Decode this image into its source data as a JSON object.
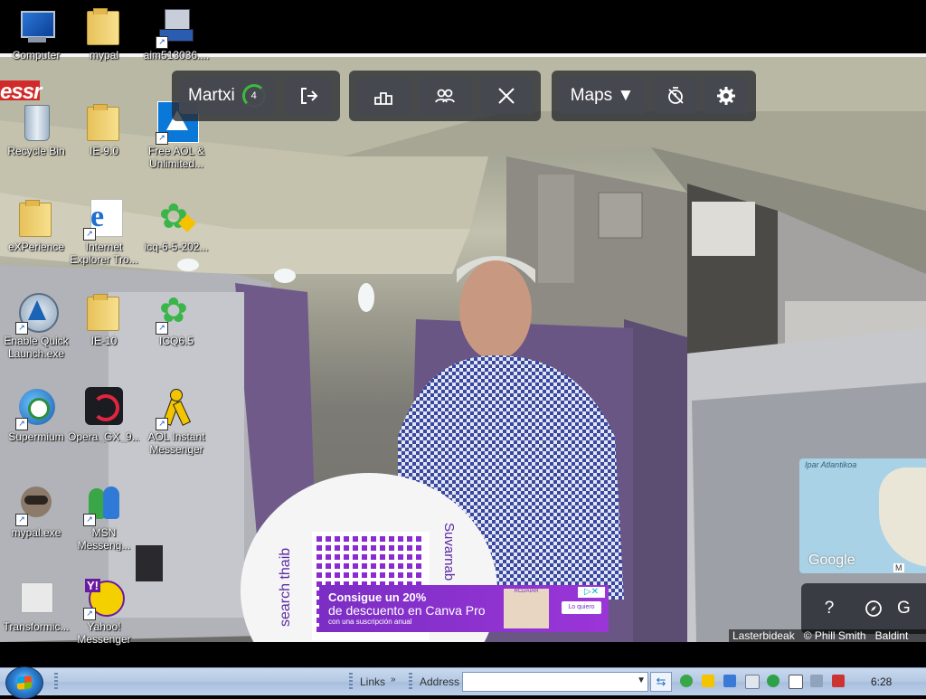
{
  "desktop": {
    "icons": [
      {
        "label": "Computer",
        "icon": "computer-icon"
      },
      {
        "label": "mypal",
        "icon": "folder-icon"
      },
      {
        "label": "aim513036....",
        "icon": "installer-icon"
      },
      {
        "label": "Recycle Bin",
        "icon": "recycle-bin-icon"
      },
      {
        "label": "IE-9.0",
        "icon": "folder-icon"
      },
      {
        "label": "Free AOL & Unlimited...",
        "icon": "aol-icon"
      },
      {
        "label": "eXPerience",
        "icon": "folder-icon"
      },
      {
        "label": "Internet Explorer Tro...",
        "icon": "internet-explorer-icon"
      },
      {
        "label": "icq-6-5-202...",
        "icon": "icq-installer-icon"
      },
      {
        "label": "Enable Quick Launch.exe",
        "icon": "quick-launch-icon"
      },
      {
        "label": "IE-10",
        "icon": "folder-icon"
      },
      {
        "label": "ICQ6.5",
        "icon": "icq-icon"
      },
      {
        "label": "Supermium",
        "icon": "supermium-icon"
      },
      {
        "label": "Opera_GX_9...",
        "icon": "opera-gx-icon"
      },
      {
        "label": "AOL Instant Messenger",
        "icon": "aim-icon"
      },
      {
        "label": "mypal.exe",
        "icon": "mypal-raccoon-icon"
      },
      {
        "label": "MSN Messeng...",
        "icon": "msn-messenger-icon"
      },
      {
        "label": "Transformic...",
        "icon": "transformice-icon"
      },
      {
        "label": "Yahoo! Messenger",
        "icon": "yahoo-messenger-icon"
      }
    ],
    "partial_logo_text": "essr"
  },
  "game_toolbar": {
    "player_name": "Martxi",
    "player_level": "4",
    "maps_label": "Maps ▼",
    "icons": [
      "exit-icon",
      "leaderboard-icon",
      "multiplayer-icon",
      "battle-icon",
      "timer-off-icon",
      "settings-icon"
    ]
  },
  "minimap": {
    "sea_label": "Ipar Atlantikoa",
    "google_logo": "Google",
    "keyboard_label": "M"
  },
  "bottom_panel": {
    "help_label": "?",
    "guess_label": "G"
  },
  "ad": {
    "line1": "Consigue un 20%",
    "line2": "de descuento en Canva Pro",
    "line3": "con una suscripción anual",
    "brand": "RCDAIAR",
    "cta": "Lo quiero"
  },
  "attribution": {
    "place": "Lasterbideak",
    "credit": "© Phill Smith",
    "extra": "Baldint"
  },
  "scene_sign": {
    "text1": "Suvarnab",
    "text2": "search thaib"
  },
  "taskbar": {
    "links_label": "Links",
    "address_label": "Address",
    "address_value": "",
    "clock": "6:28"
  },
  "colors": {
    "taskbar": "#b5c9e4",
    "toolbar_bg": "#2a2c30",
    "ad_purple": "#7b2ec4",
    "level_ring": "#3dbb3d"
  }
}
